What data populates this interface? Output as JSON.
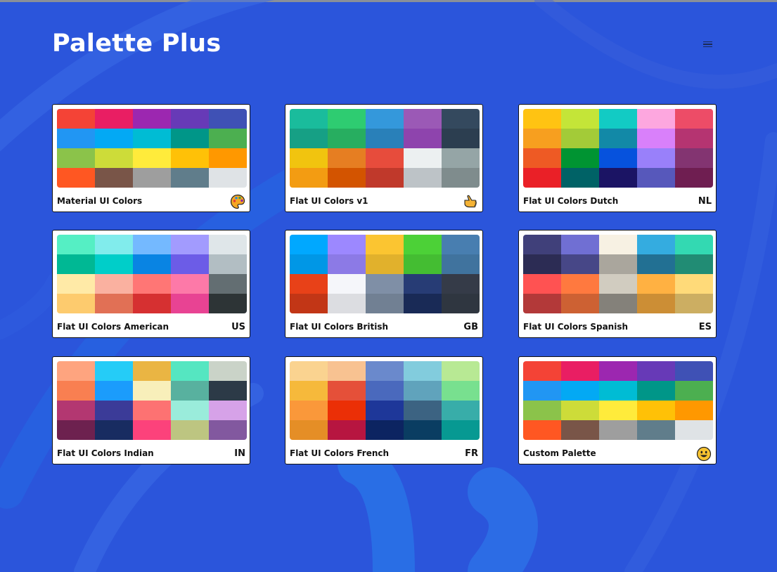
{
  "app": {
    "title": "Palette Plus"
  },
  "menu": {
    "icon": "hamburger-menu-icon"
  },
  "palettes": [
    {
      "name": "Material UI Colors",
      "icon": "palette-icon",
      "colors": [
        "#f44336",
        "#e91e63",
        "#9c27b0",
        "#673ab7",
        "#3f51b5",
        "#2196f3",
        "#03a9f4",
        "#00bcd4",
        "#009688",
        "#4caf50",
        "#8bc34a",
        "#cddc39",
        "#ffeb3b",
        "#ffc107",
        "#ff9800",
        "#ff5722",
        "#795548",
        "#9e9e9e",
        "#607d8b",
        "#dfe3e6"
      ]
    },
    {
      "name": "Flat UI Colors v1",
      "icon": "hand-icon",
      "colors": [
        "#1abc9c",
        "#2ecc71",
        "#3498db",
        "#9b59b6",
        "#34495e",
        "#16a085",
        "#27ae60",
        "#2980b9",
        "#8e44ad",
        "#2c3e50",
        "#f1c40f",
        "#e67e22",
        "#e74c3c",
        "#ecf0f1",
        "#95a5a6",
        "#f39c12",
        "#d35400",
        "#c0392b",
        "#bdc3c7",
        "#7f8c8d"
      ]
    },
    {
      "name": "Flat UI Colors Dutch",
      "badge": "NL",
      "colors": [
        "#ffc312",
        "#c4e538",
        "#12cbc4",
        "#fda7df",
        "#ed4c67",
        "#f79f1f",
        "#a3cb38",
        "#1289a7",
        "#d980fa",
        "#b53471",
        "#ee5a24",
        "#009432",
        "#0652dd",
        "#9980fa",
        "#833471",
        "#ea2027",
        "#006266",
        "#1b1464",
        "#5758bb",
        "#6f1e51"
      ]
    },
    {
      "name": "Flat UI Colors American",
      "badge": "US",
      "colors": [
        "#55efc4",
        "#81ecec",
        "#74b9ff",
        "#a29bfe",
        "#dfe6e9",
        "#00b894",
        "#00cec9",
        "#0984e3",
        "#6c5ce7",
        "#b2bec3",
        "#ffeaa7",
        "#fab1a0",
        "#ff7675",
        "#fd79a8",
        "#636e72",
        "#fdcb6e",
        "#e17055",
        "#d63031",
        "#e84393",
        "#2d3436"
      ]
    },
    {
      "name": "Flat UI Colors British",
      "badge": "GB",
      "colors": [
        "#00a8ff",
        "#9c88ff",
        "#fbc531",
        "#4cd137",
        "#487eb0",
        "#0097e6",
        "#8c7ae6",
        "#e1b12c",
        "#44bd32",
        "#40739e",
        "#e84118",
        "#f5f6fa",
        "#7f8fa6",
        "#273c75",
        "#353b48",
        "#c23616",
        "#dcdde1",
        "#718093",
        "#192a56",
        "#2f3640"
      ]
    },
    {
      "name": "Flat UI Colors Spanish",
      "badge": "ES",
      "colors": [
        "#40407a",
        "#706fd3",
        "#f7f1e3",
        "#34ace0",
        "#33d9b2",
        "#2c2c54",
        "#474787",
        "#aaa69d",
        "#227093",
        "#218c74",
        "#ff5252",
        "#ff793f",
        "#d1ccc0",
        "#ffb142",
        "#ffda79",
        "#b33939",
        "#cd6133",
        "#84817a",
        "#cc8e35",
        "#ccae62"
      ]
    },
    {
      "name": "Flat UI Colors Indian",
      "badge": "IN",
      "colors": [
        "#fea47f",
        "#25ccf7",
        "#eab543",
        "#55e6c1",
        "#cad3c8",
        "#f97f51",
        "#1b9cfc",
        "#f8efba",
        "#58b19f",
        "#2c3a47",
        "#b33771",
        "#3b3b98",
        "#fd7272",
        "#9aecdb",
        "#d6a2e8",
        "#6d214f",
        "#182c61",
        "#fc427b",
        "#bdc581",
        "#82589f"
      ]
    },
    {
      "name": "Flat UI Colors French",
      "badge": "FR",
      "colors": [
        "#fad390",
        "#f8c291",
        "#6a89cc",
        "#82ccdd",
        "#b8e994",
        "#f6b93b",
        "#e55039",
        "#4a69bd",
        "#60a3bc",
        "#78e08f",
        "#fa983a",
        "#eb2f06",
        "#1e3799",
        "#3c6382",
        "#38ada9",
        "#e58e26",
        "#b71540",
        "#0c2461",
        "#0a3d62",
        "#079992"
      ]
    },
    {
      "name": "Custom Palette",
      "icon": "smiley-icon",
      "colors": [
        "#f44336",
        "#e91e63",
        "#9c27b0",
        "#673ab7",
        "#3f51b5",
        "#2196f3",
        "#03a9f4",
        "#00bcd4",
        "#009688",
        "#4caf50",
        "#8bc34a",
        "#cddc39",
        "#ffeb3b",
        "#ffc107",
        "#ff9800",
        "#ff5722",
        "#795548",
        "#9e9e9e",
        "#607d8b",
        "#dfe3e6"
      ]
    }
  ]
}
